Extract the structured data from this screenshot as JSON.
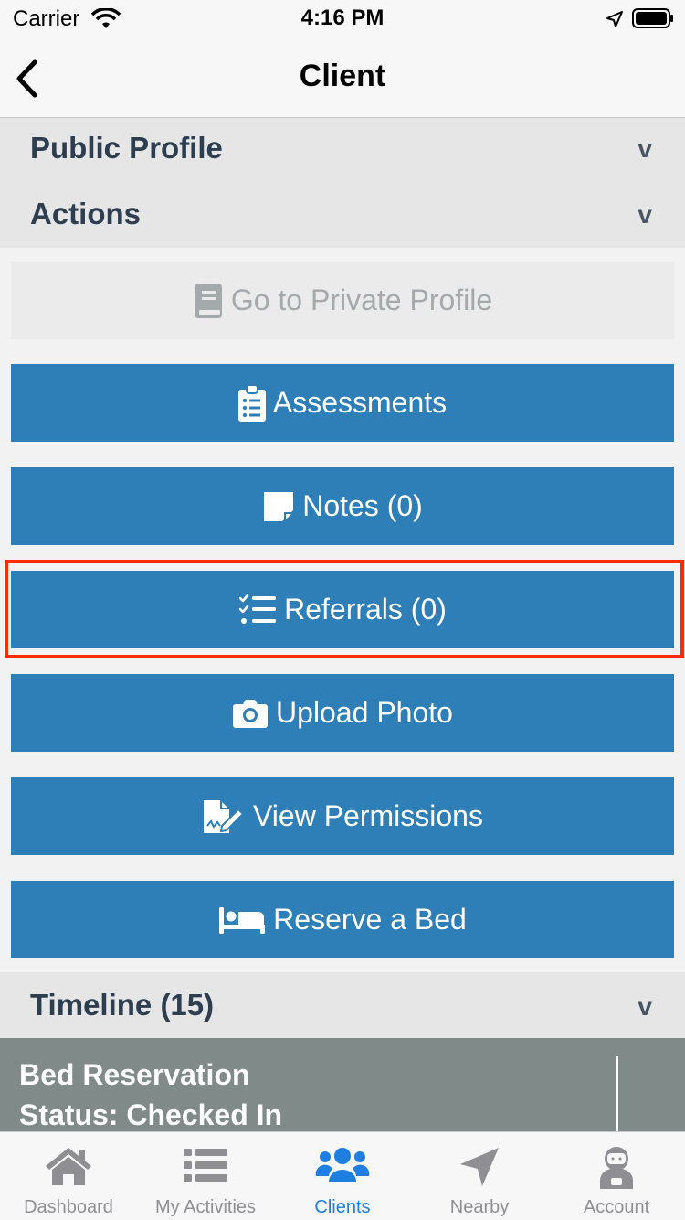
{
  "status_bar": {
    "carrier": "Carrier",
    "time": "4:16 PM",
    "icons": [
      "wifi-icon",
      "location-arrow-icon",
      "battery-icon"
    ]
  },
  "nav": {
    "title": "Client",
    "back_icon": "chevron-left-icon"
  },
  "sections": {
    "public_profile": {
      "label": "Public Profile",
      "chevron": "v"
    },
    "actions": {
      "label": "Actions",
      "chevron": "v"
    },
    "timeline": {
      "label": "Timeline (15)",
      "chevron": "v"
    }
  },
  "actions": [
    {
      "label": "Go to Private Profile",
      "icon": "book-icon",
      "enabled": false
    },
    {
      "label": "Assessments",
      "icon": "clipboard-list-icon",
      "enabled": true
    },
    {
      "label": "Notes (0)",
      "icon": "sticky-note-icon",
      "enabled": true
    },
    {
      "label": "Referrals (0)",
      "icon": "checklist-icon",
      "enabled": true,
      "highlighted": true
    },
    {
      "label": "Upload Photo",
      "icon": "camera-icon",
      "enabled": true
    },
    {
      "label": "View Permissions",
      "icon": "signed-document-icon",
      "enabled": true
    },
    {
      "label": "Reserve a Bed",
      "icon": "bed-icon",
      "enabled": true
    }
  ],
  "timeline_item": {
    "line1": "Bed Reservation",
    "line2": "Status: Checked In"
  },
  "tabs": [
    {
      "label": "Dashboard",
      "icon": "home-icon",
      "active": false
    },
    {
      "label": "My Activities",
      "icon": "list-icon",
      "active": false
    },
    {
      "label": "Clients",
      "icon": "users-icon",
      "active": true
    },
    {
      "label": "Nearby",
      "icon": "location-arrow-icon",
      "active": false
    },
    {
      "label": "Account",
      "icon": "astronaut-icon",
      "active": false
    }
  ],
  "colors": {
    "button": "#2e7eb8",
    "button_disabled": "#ebebeb",
    "highlight": "#ff2a00",
    "active_tab": "#1e7fe0",
    "timeline_card": "#808a89",
    "section_header": "#e6e6e6"
  }
}
